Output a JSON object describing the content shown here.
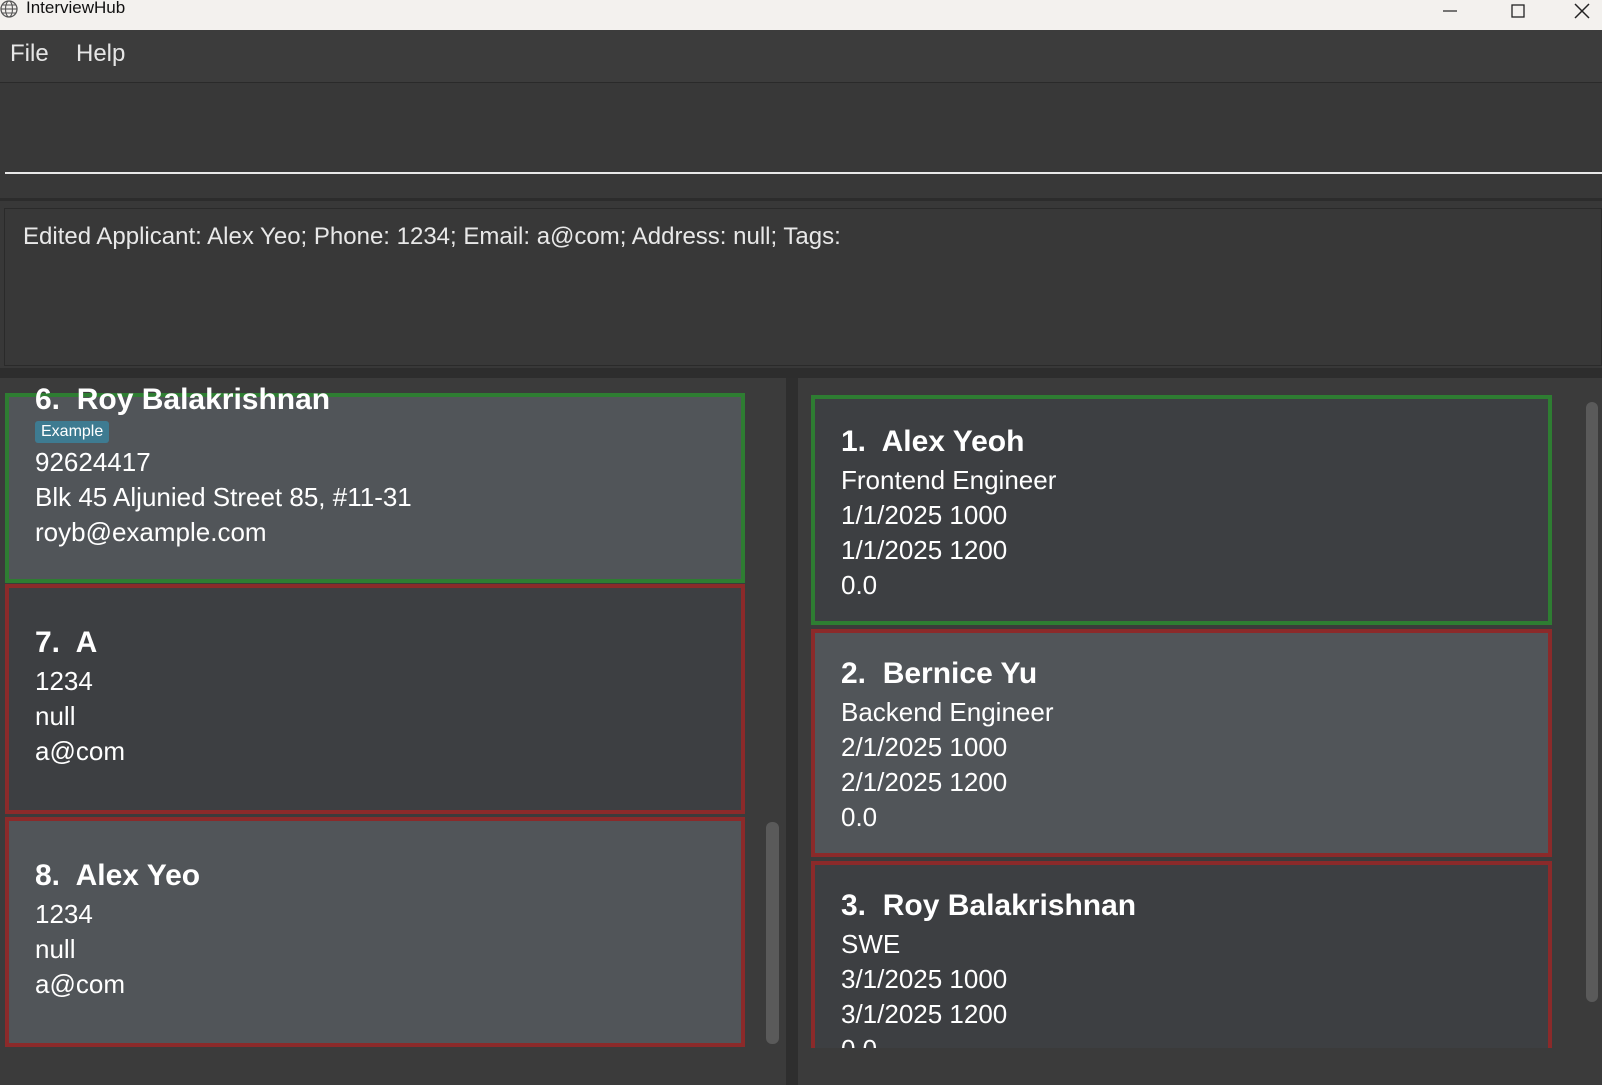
{
  "window": {
    "title": "InterviewHub"
  },
  "menu": {
    "items": [
      "File",
      "Help"
    ]
  },
  "command": {
    "value": ""
  },
  "result": {
    "text": "Edited Applicant: Alex Yeo; Phone: 1234; Email: a@com; Address: null; Tags:"
  },
  "applicants": [
    {
      "index": "6.",
      "name": "Roy Balakrishnan",
      "tag": "Example",
      "phone": "92624417",
      "address": "Blk 45 Aljunied Street 85, #11-31",
      "email": "royb@example.com"
    },
    {
      "index": "7.",
      "name": "A",
      "phone": "1234",
      "address": "null",
      "email": "a@com"
    },
    {
      "index": "8.",
      "name": "Alex Yeo",
      "phone": "1234",
      "address": "null",
      "email": "a@com"
    }
  ],
  "interviews": [
    {
      "index": "1.",
      "name": "Alex Yeoh",
      "role": "Frontend Engineer",
      "start": "1/1/2025 1000",
      "end": "1/1/2025 1200",
      "score": "0.0"
    },
    {
      "index": "2.",
      "name": "Bernice Yu",
      "role": "Backend Engineer",
      "start": "2/1/2025 1000",
      "end": "2/1/2025 1200",
      "score": "0.0"
    },
    {
      "index": "3.",
      "name": "Roy Balakrishnan",
      "role": "SWE",
      "start": "3/1/2025 1000",
      "end": "3/1/2025 1200",
      "score": "0.0"
    }
  ],
  "colors": {
    "selected_border": "#2e7d32",
    "card_border": "#8b2a2a",
    "tag_bg": "#3e7b91"
  },
  "icons": [
    "globe-icon",
    "minimize-icon",
    "maximize-icon",
    "close-icon"
  ]
}
